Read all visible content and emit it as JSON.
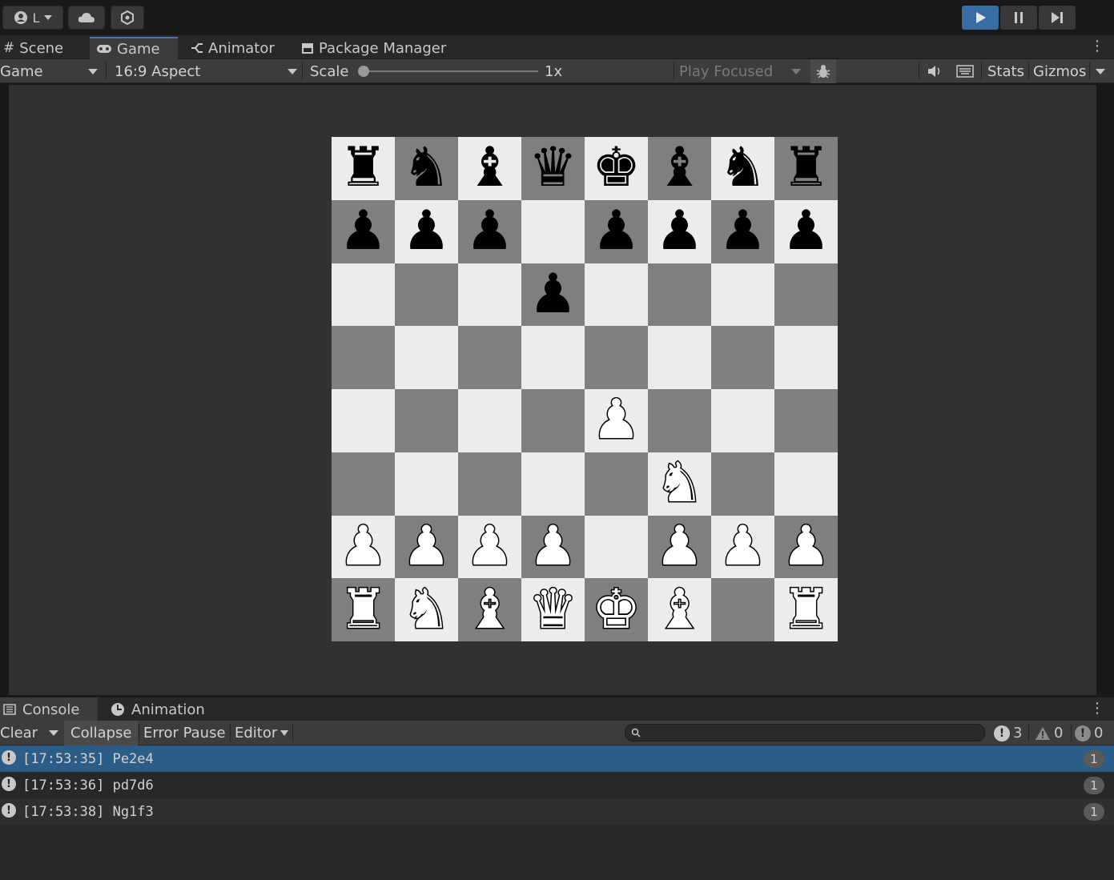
{
  "toolbar": {
    "account_label": "L",
    "play_active": true
  },
  "tabs": {
    "scene": "Scene",
    "game": "Game",
    "animator": "Animator",
    "package_manager": "Package Manager"
  },
  "game_toolbar": {
    "display": "Game",
    "aspect": "16:9 Aspect",
    "scale_label": "Scale",
    "scale_value": "1x",
    "play_mode": "Play Focused",
    "stats": "Stats",
    "gizmos": "Gizmos"
  },
  "board": {
    "colors": {
      "light": "#ececec",
      "dark": "#7f7f7f"
    },
    "rows": [
      [
        "br",
        "bn",
        "bb",
        "bq",
        "bk",
        "bb",
        "bn",
        "br"
      ],
      [
        "bp",
        "bp",
        "bp",
        "",
        "bp",
        "bp",
        "bp",
        "bp"
      ],
      [
        "",
        "",
        "",
        "bp",
        "",
        "",
        "",
        ""
      ],
      [
        "",
        "",
        "",
        "",
        "",
        "",
        "",
        ""
      ],
      [
        "",
        "",
        "",
        "",
        "wp",
        "",
        "",
        ""
      ],
      [
        "",
        "",
        "",
        "",
        "",
        "wn",
        "",
        ""
      ],
      [
        "wp",
        "wp",
        "wp",
        "wp",
        "",
        "wp",
        "wp",
        "wp"
      ],
      [
        "wr",
        "wn",
        "wb",
        "wq",
        "wk",
        "wb",
        "",
        "wr"
      ]
    ]
  },
  "console_tabs": {
    "console": "Console",
    "animation": "Animation"
  },
  "console_toolbar": {
    "clear": "Clear",
    "collapse": "Collapse",
    "error_pause": "Error Pause",
    "editor": "Editor",
    "search_placeholder": "",
    "log_count": "3",
    "warn_count": "0",
    "error_count": "0"
  },
  "logs": [
    {
      "text": "[17:53:35] Pe2e4",
      "count": "1",
      "selected": true
    },
    {
      "text": "[17:53:36] pd7d6",
      "count": "1",
      "selected": false
    },
    {
      "text": "[17:53:38] Ng1f3",
      "count": "1",
      "selected": false
    }
  ]
}
